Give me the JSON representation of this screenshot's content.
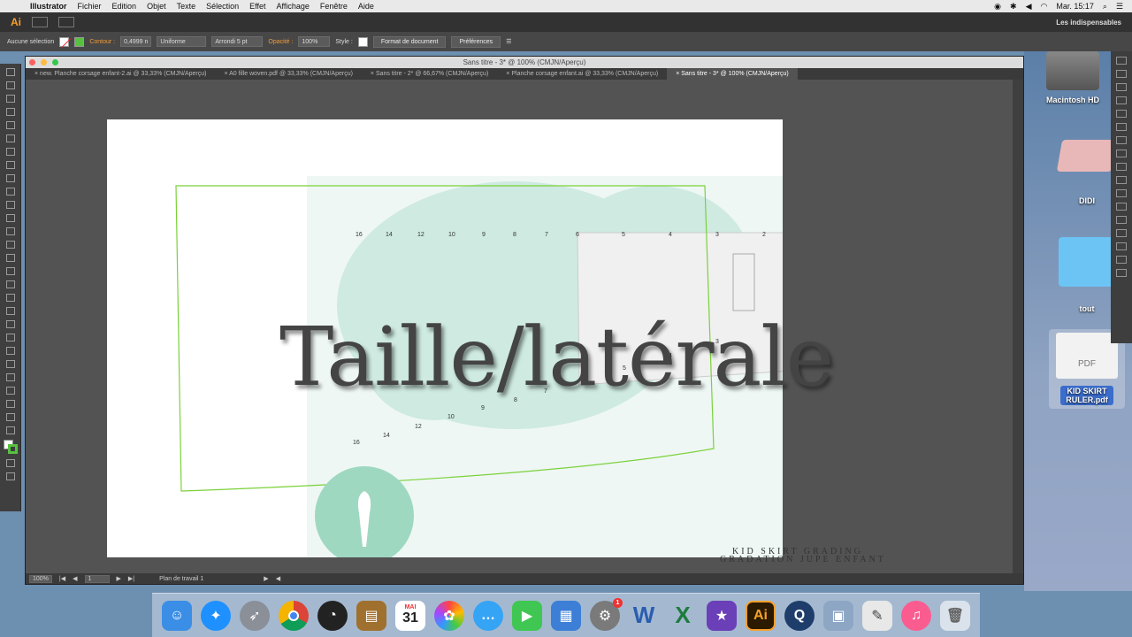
{
  "menubar": {
    "apple_icon": "apple-icon",
    "items": [
      "Illustrator",
      "Fichier",
      "Edition",
      "Objet",
      "Texte",
      "Sélection",
      "Effet",
      "Affichage",
      "Fenêtre",
      "Aide"
    ],
    "clock": "Mar. 15:17"
  },
  "appbar": {
    "logo": "Ai",
    "workspace": "Les indispensables"
  },
  "controlbar": {
    "selection": "Aucune sélection",
    "contour_label": "Contour :",
    "stroke_weight": "0,4999 n",
    "stroke_style": "Uniforme",
    "brush": "Arrondi 5 pt",
    "opacity_label": "Opacité :",
    "opacity_value": "100%",
    "style_label": "Style :",
    "doc_button": "Format de document",
    "prefs_button": "Préférences"
  },
  "window": {
    "title": "Sans titre - 3* @ 100% (CMJN/Aperçu)",
    "tabs": [
      "new. Planche corsage enfant-2.ai @ 33,33% (CMJN/Aperçu)",
      "A0 fille woven.pdf @ 33,33% (CMJN/Aperçu)",
      "Sans titre - 2* @ 66,67% (CMJN/Aperçu)",
      "Planche corsage enfant.ai @ 33,33% (CMJN/Aperçu)",
      "Sans titre - 3* @ 100% (CMJN/Aperçu)"
    ],
    "active_tab": 4
  },
  "artwork": {
    "title": "Taille/latérale",
    "top_sizes": [
      "16",
      "14",
      "12",
      "10",
      "9",
      "8",
      "7",
      "6",
      "5",
      "4",
      "3",
      "2"
    ],
    "bottom_sizes": [
      "16",
      "14",
      "12",
      "10",
      "9",
      "8",
      "7"
    ],
    "inner_sizes": [
      "5",
      "4",
      "3"
    ],
    "footer_line1": "KID SKIRT GRADING",
    "footer_line2": "GRADATION JUPE ENFANT"
  },
  "statusbar": {
    "zoom": "100%",
    "page": "1",
    "artboard_name": "Plan de travail 1"
  },
  "desktop": {
    "items": [
      "Macintosh HD",
      "DIDI",
      "tout",
      "KID SKIRT RULER.pdf"
    ],
    "pdf_label": "PDF"
  },
  "dock": {
    "apps": [
      "Finder",
      "Safari",
      "Launchpad",
      "Chrome",
      "Instruments",
      "Notes",
      "Calendar",
      "Photos",
      "Messages",
      "FaceTime",
      "Keynote",
      "Préférences Système",
      "Word",
      "Excel",
      "iMovie",
      "Illustrator",
      "QuickTime",
      "Aperçu",
      "TextEdit",
      "iTunes",
      "Corbeille"
    ],
    "calendar_month": "MAI",
    "calendar_day": "31",
    "badge": "1"
  }
}
